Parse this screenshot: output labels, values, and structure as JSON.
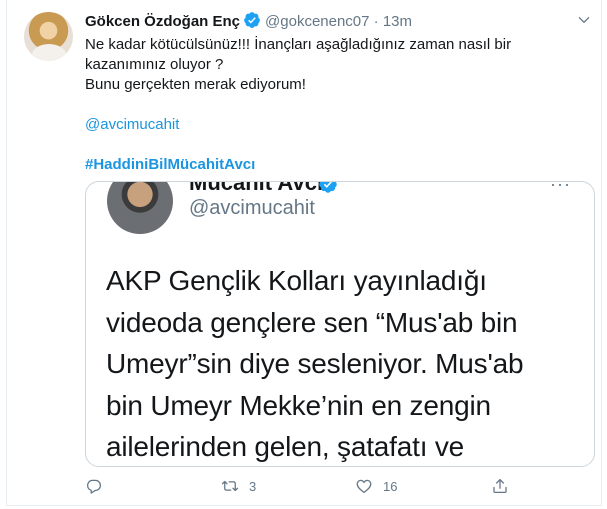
{
  "tweet": {
    "author_name": "Gökcen Özdoğan Enç",
    "handle": "@gokcenenc07",
    "separator": "·",
    "time": "13m",
    "text_line1": "Ne kadar kötücülsünüz!!! İnançları aşağladığınız zaman nasıl bir",
    "text_line2": "kazanımınız oluyor ?",
    "text_line3": "Bunu gerçekten merak ediyorum!",
    "mention": "@avcimucahit",
    "hashtag": "#HaddiniBilMücahitAvcı"
  },
  "embedded": {
    "name": "Mücahit Avcı",
    "handle": "@avcimucahit",
    "more": "···",
    "lines": [
      "AKP Gençlik Kolları yayınladığı",
      "videoda gençlere sen “Mus'ab bin",
      "Umeyr”sin diye sesleniyor. Mus'ab",
      "bin Umeyr Mekke’nin en zengin",
      "ailelerinden gelen, şatafatı ve"
    ]
  },
  "actions": {
    "reply_count": "",
    "retweet_count": "3",
    "like_count": "16"
  },
  "colors": {
    "link": "#1b95e0",
    "muted": "#657786",
    "verified": "#1da1f2"
  },
  "icons": [
    "verified-badge-icon",
    "chevron-down-icon",
    "reply-icon",
    "retweet-icon",
    "like-icon",
    "share-icon"
  ]
}
